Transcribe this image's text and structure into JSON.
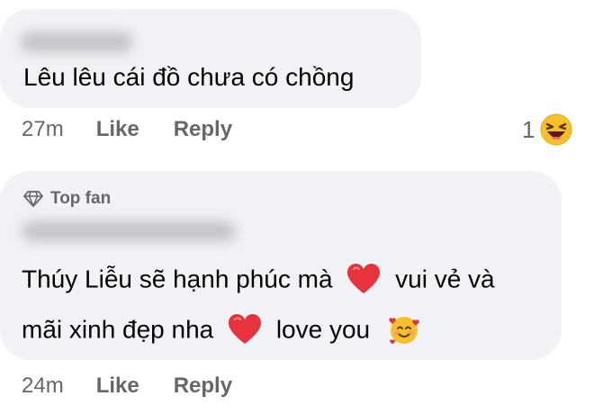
{
  "comments": [
    {
      "text": "Lêu lêu cái đồ chưa có chồng",
      "time": "27m",
      "like_label": "Like",
      "reply_label": "Reply",
      "reaction_count": "1"
    },
    {
      "badge_label": "Top fan",
      "line1_part1": "Thúy Liễu sẽ hạnh phúc mà",
      "line1_part2": "vui vẻ và",
      "line2_part1": "mãi xinh đẹp nha",
      "line2_part2": "love you",
      "time": "24m",
      "like_label": "Like",
      "reply_label": "Reply"
    }
  ],
  "colors": {
    "bubble_bg": "#f0f2f5",
    "meta_text": "#65676b",
    "body_text": "#050505",
    "heart": "#e8323c",
    "emoji_yellow": "#f7c02b"
  },
  "icons": [
    "diamond-icon",
    "heart-emoji",
    "smiling-face-with-hearts-emoji",
    "laughing-emoji"
  ]
}
